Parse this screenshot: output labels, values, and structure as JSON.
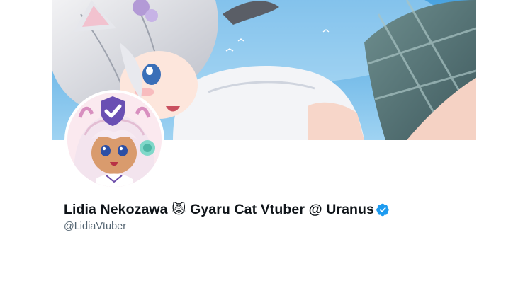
{
  "profile": {
    "display_name": "Lidia Nekozawa 😾 Gyaru Cat Vtuber @ Uranus",
    "handle": "@LidiaVtuber",
    "verified_icon": "verified-badge-icon",
    "banner_image": "anime-cat-girl-banner",
    "avatar_image": "anime-cat-girl-avatar-with-verified-shield"
  },
  "colors": {
    "name_text": "#0f1419",
    "handle_text": "#536471",
    "verified_blue": "#1d9bf0",
    "banner_sky": "#6fb8e8"
  }
}
